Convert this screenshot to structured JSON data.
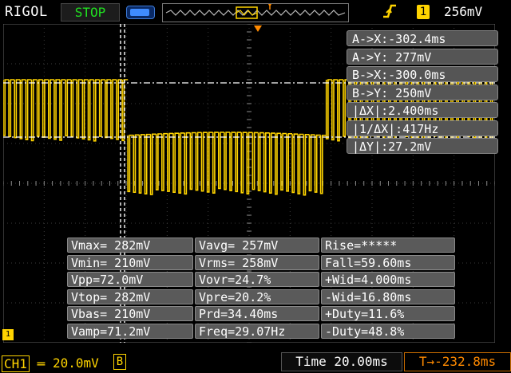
{
  "header": {
    "brand": "RIGOL",
    "run_state": "STOP",
    "trigger_channel": "1",
    "trigger_level": "256mV"
  },
  "cursor_readouts": [
    "A->X:-302.4ms",
    "A->Y: 277mV",
    "B->X:-300.0ms",
    "B->Y: 250mV",
    "|ΔX|:2.400ms",
    "|1/ΔX|:417Hz",
    "|ΔY|:27.2mV"
  ],
  "measurements": [
    [
      "Vmax= 282mV",
      "Vavg= 257mV",
      "Rise=*****"
    ],
    [
      "Vmin= 210mV",
      "Vrms= 258mV",
      "Fall=59.60ms"
    ],
    [
      "Vpp=72.0mV",
      "Vovr=24.7%",
      "+Wid=4.000ms"
    ],
    [
      "Vtop= 282mV",
      "Vpre=20.2%",
      "-Wid=16.80ms"
    ],
    [
      "Vbas= 210mV",
      "Prd=34.40ms",
      "+Duty=11.6%"
    ],
    [
      "Vamp=71.2mV",
      "Freq=29.07Hz",
      "-Duty=48.8%"
    ]
  ],
  "footer": {
    "channel_label": "CH1",
    "channel_scale": "20.0mV",
    "bandwidth_mark": "B",
    "timebase": "Time 20.00ms",
    "trigger_position": "-232.8ms"
  },
  "colors": {
    "trace": "#ffd400",
    "stop_text": "#20e020",
    "trigger_offset": "#ff8a00",
    "panel": "#555555"
  }
}
